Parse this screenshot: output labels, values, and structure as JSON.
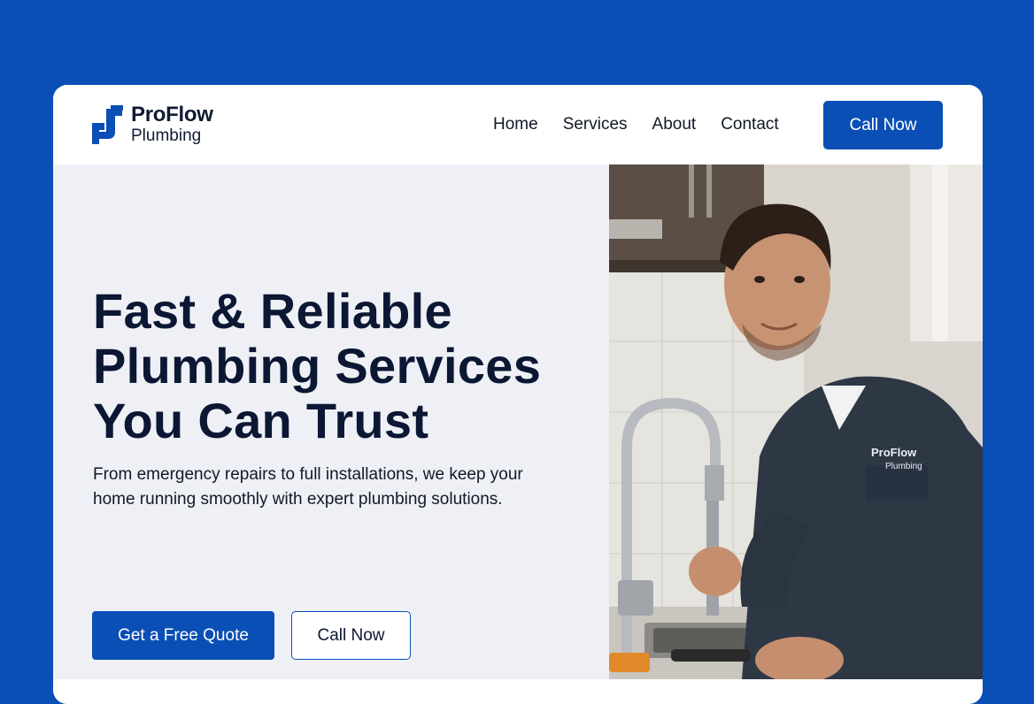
{
  "theme": {
    "background": "#0a4fb5",
    "accent": "#0a4fb5",
    "hero_background": "#eef0f5",
    "text_dark": "#0b1733"
  },
  "brand": {
    "name": "ProFlow",
    "tagline": "Plumbing",
    "logo_icon": "pipe-logo-icon"
  },
  "nav": {
    "items": [
      "Home",
      "Services",
      "About",
      "Contact"
    ],
    "cta_label": "Call Now"
  },
  "hero": {
    "title_lines": [
      "Fast & Reliable",
      "Plumbing Services",
      "You Can Trust"
    ],
    "subtitle_lines": [
      "From emergency repairs to full installations, we keep your",
      "home running smoothly with expert plumbing solutions."
    ],
    "primary_button": "Get a Free Quote",
    "secondary_button": "Call Now"
  },
  "photo": {
    "uniform_logo_name": "ProFlow",
    "uniform_logo_sub": "Plumbing"
  }
}
